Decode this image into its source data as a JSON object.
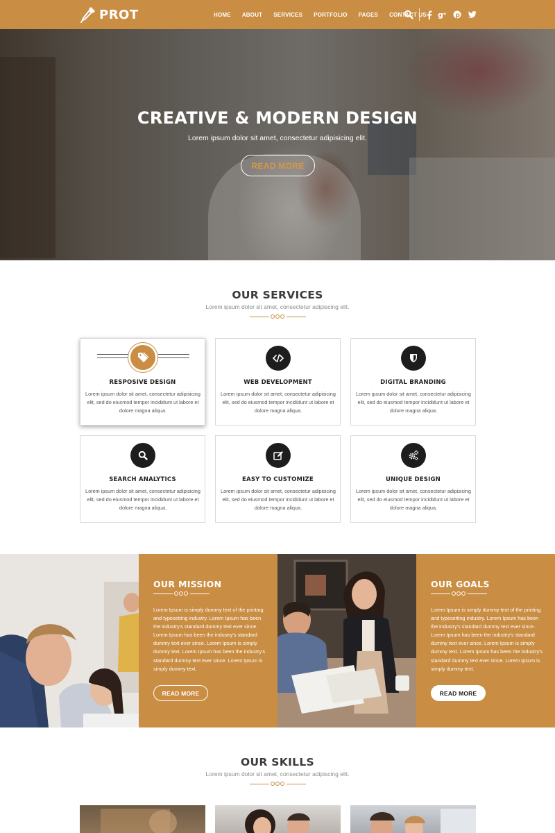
{
  "brand": {
    "name": "PROT",
    "accent": "#c98d43",
    "dark": "#1d1d1d"
  },
  "nav": {
    "items": [
      "HOME",
      "ABOUT",
      "SERVICES",
      "PORTFOLIO",
      "PAGES",
      "CONTACT US"
    ],
    "icons": [
      "search-icon",
      "facebook-icon",
      "google-plus-icon",
      "pinterest-icon",
      "twitter-icon"
    ]
  },
  "hero": {
    "title": "CREATIVE & MODERN DESIGN",
    "subtitle": "Lorem ipsum dolor sit amet, consectetur adipisicing elit.",
    "button": "READ MORE"
  },
  "services": {
    "title": "OUR SERVICES",
    "subtitle": "Lorem ipsum dolor sit amet, consectetur adipiscing elit.",
    "items": [
      {
        "title": "RESPOSIVE DESIGN",
        "icon": "tag-icon",
        "text": "Lorem ipsum dolor sit amet, consectetur adipisicing elit, sed do eiusmod tempor incididunt ut labore et dolore magna aliqua."
      },
      {
        "title": "WEB DEVELOPMENT",
        "icon": "code-icon",
        "text": "Lorem ipsum dolor sit amet, consectetur adipisicing elit, sed do eiusmod tempor incididunt ut labore et dolore magna aliqua."
      },
      {
        "title": "DIGITAL BRANDING",
        "icon": "shield-icon",
        "text": "Lorem ipsum dolor sit amet, consectetur adipisicing elit, sed do eiusmod tempor incididunt ut labore et dolore magna aliqua."
      },
      {
        "title": "SEARCH ANALYTICS",
        "icon": "search-icon",
        "text": "Lorem ipsum dolor sit amet, consectetur adipisicing elit, sed do eiusmod tempor incididunt ut labore et dolore magna aliqua."
      },
      {
        "title": "EASY TO CUSTOMIZE",
        "icon": "edit-icon",
        "text": "Lorem ipsum dolor sit amet, consectetur adipisicing elit, sed do eiusmod tempor incididunt ut labore et dolore magna aliqua."
      },
      {
        "title": "UNIQUE DESIGN",
        "icon": "gears-icon",
        "text": "Lorem ipsum dolor sit amet, consectetur adipisicing elit, sed do eiusmod tempor incididunt ut labore et dolore magna aliqua."
      }
    ]
  },
  "mission": {
    "title": "OUR MISSION",
    "text": "Lorem Ipsum is simply dummy text of the printing and typesetting industry. Lorem Ipsum has been the industry's standard dummy text ever since. Lorem Ipsum has been the industry's standard dummy text ever since. Lorem Ipsum is simply dummy text.  Lorem Ipsum has been the industry's standard dummy text ever since. Lorem Ipsum is simply dummy text.",
    "button": "READ MORE"
  },
  "goals": {
    "title": "OUR GOALS",
    "text": "Lorem Ipsum is simply dummy text of the printing and typesetting industry. Lorem Ipsum has been the industry's standard dummy text ever since. Lorem Ipsum has been the industry's standard dummy text ever since. Lorem Ipsum is simply dummy text.  Lorem Ipsum has been the industry's standard dummy text ever since. Lorem Ipsum is simply dummy text.",
    "button": "READ MORE"
  },
  "skills": {
    "title": "OUR SKILLS",
    "subtitle": "Lorem ipsum dolor sit amet, consectetur adipiscing elit."
  }
}
